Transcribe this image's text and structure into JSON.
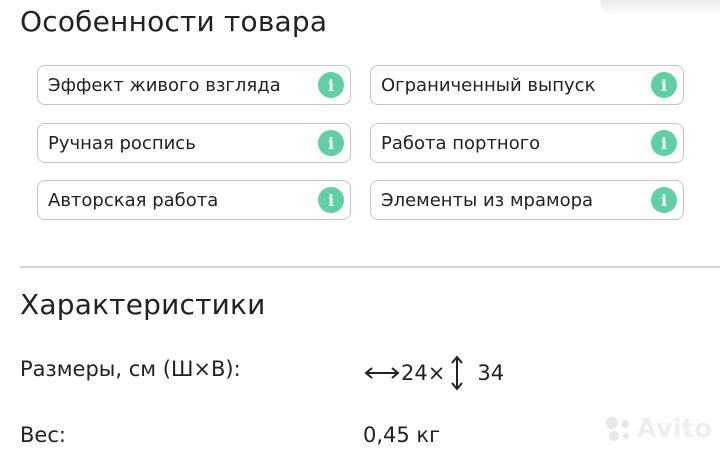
{
  "features": {
    "title": "Особенности товара",
    "items": [
      {
        "label": "Эффект живого взгляда"
      },
      {
        "label": "Ограниченный выпуск"
      },
      {
        "label": "Ручная роспись"
      },
      {
        "label": "Работа портного"
      },
      {
        "label": "Авторская работа"
      },
      {
        "label": "Элементы из мрамора"
      }
    ],
    "info_glyph": "i",
    "accent_color": "#5fcfa4"
  },
  "specs": {
    "title": "Характеристики",
    "size": {
      "label": "Размеры, см (Ш×В):",
      "width": "24×",
      "height": "34"
    },
    "weight": {
      "label": "Вес:",
      "value": "0,45 кг"
    }
  },
  "watermark": {
    "text": "Avito"
  }
}
